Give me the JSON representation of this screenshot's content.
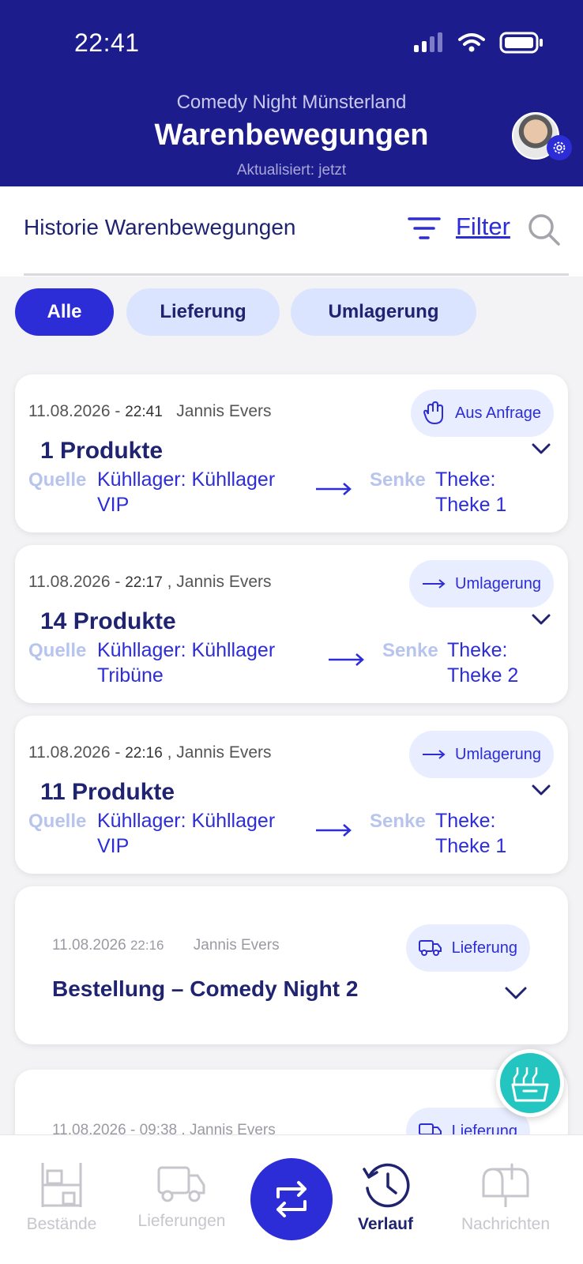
{
  "status_bar": {
    "time": "22:41"
  },
  "header": {
    "subtitle": "Comedy Night Münsterland",
    "title": "Warenbewegungen",
    "updated": "Aktualisiert: jetzt"
  },
  "section": {
    "title": "Historie Warenbewegungen",
    "filter_label": "Filter"
  },
  "chips": [
    {
      "label": "Alle",
      "active": true
    },
    {
      "label": "Lieferung",
      "active": false
    },
    {
      "label": "Umlagerung",
      "active": false
    }
  ],
  "cards": [
    {
      "date": "11.08.2026 -",
      "time": "22:41",
      "user": "Jannis Evers",
      "badge": "Aus Anfrage",
      "badge_icon": "hand-wave-icon",
      "count": "1 Produkte",
      "source_label": "Quelle",
      "source_line1": "Kühllager: Kühllager",
      "source_line2": "VIP",
      "sink_label": "Senke",
      "sink_line1": "Theke:",
      "sink_line2": "Theke 1"
    },
    {
      "date": "11.08.2026 -",
      "time": "22:17",
      "user": ", Jannis Evers",
      "badge": "Umlagerung",
      "badge_icon": "arrow-right-icon",
      "count": "14 Produkte",
      "source_label": "Quelle",
      "source_line1": "Kühllager: Kühllager",
      "source_line2": "Tribüne",
      "sink_label": "Senke",
      "sink_line1": "Theke:",
      "sink_line2": "Theke 2"
    },
    {
      "date": "11.08.2026 -",
      "time": "22:16",
      "user": ", Jannis Evers",
      "badge": "Umlagerung",
      "badge_icon": "arrow-right-icon",
      "count": "11 Produkte",
      "source_label": "Quelle",
      "source_line1": "Kühllager: Kühllager",
      "source_line2": "VIP",
      "sink_label": "Senke",
      "sink_line1": "Theke:",
      "sink_line2": "Theke 1"
    }
  ],
  "order_card": {
    "date": "11.08.2026",
    "time": "22:16",
    "user": "Jannis Evers",
    "badge": "Lieferung",
    "title": "Bestellung – Comedy Night 2"
  },
  "partial_card": {
    "meta": "11.08.2026 - 09:38 , Jannis Evers",
    "badge": "Lieferung"
  },
  "bottom_nav": [
    {
      "label": "Bestände",
      "icon": "shelf-icon",
      "active": false
    },
    {
      "label": "Lieferungen",
      "icon": "truck-icon",
      "active": false
    },
    {
      "label": "",
      "icon": "swap-icon",
      "active": false
    },
    {
      "label": "Verlauf",
      "icon": "history-icon",
      "active": true
    },
    {
      "label": "Nachrichten",
      "icon": "mailbox-icon",
      "active": false
    }
  ],
  "colors": {
    "header": "#1c1c8c",
    "accent": "#2d2dd8",
    "chip_inactive": "#dbe4ff",
    "fab": "#23c5c0"
  }
}
